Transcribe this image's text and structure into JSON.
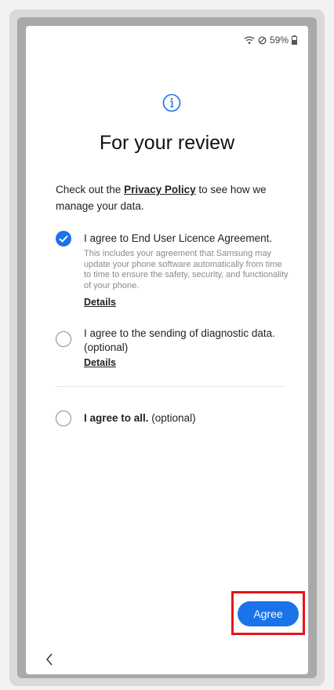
{
  "status": {
    "battery": "59%"
  },
  "title": "For your review",
  "intro": {
    "before": "Check out the ",
    "link": "Privacy Policy",
    "after": " to see how we manage your data."
  },
  "options": [
    {
      "label": "I agree to End User Licence Agreement.",
      "description": "This includes your agreement that Samsung may update your phone software automatically from time to time to ensure the safety, security, and functionality of your phone.",
      "details": "Details",
      "checked": true
    },
    {
      "label": "I agree to the sending of diagnostic data. (optional)",
      "details": "Details",
      "checked": false
    }
  ],
  "agree_all": {
    "bold": "I agree to all.",
    "suffix": " (optional)",
    "checked": false
  },
  "agree_button": "Agree",
  "colors": {
    "accent": "#1a73e8",
    "highlight": "#e8141a"
  }
}
